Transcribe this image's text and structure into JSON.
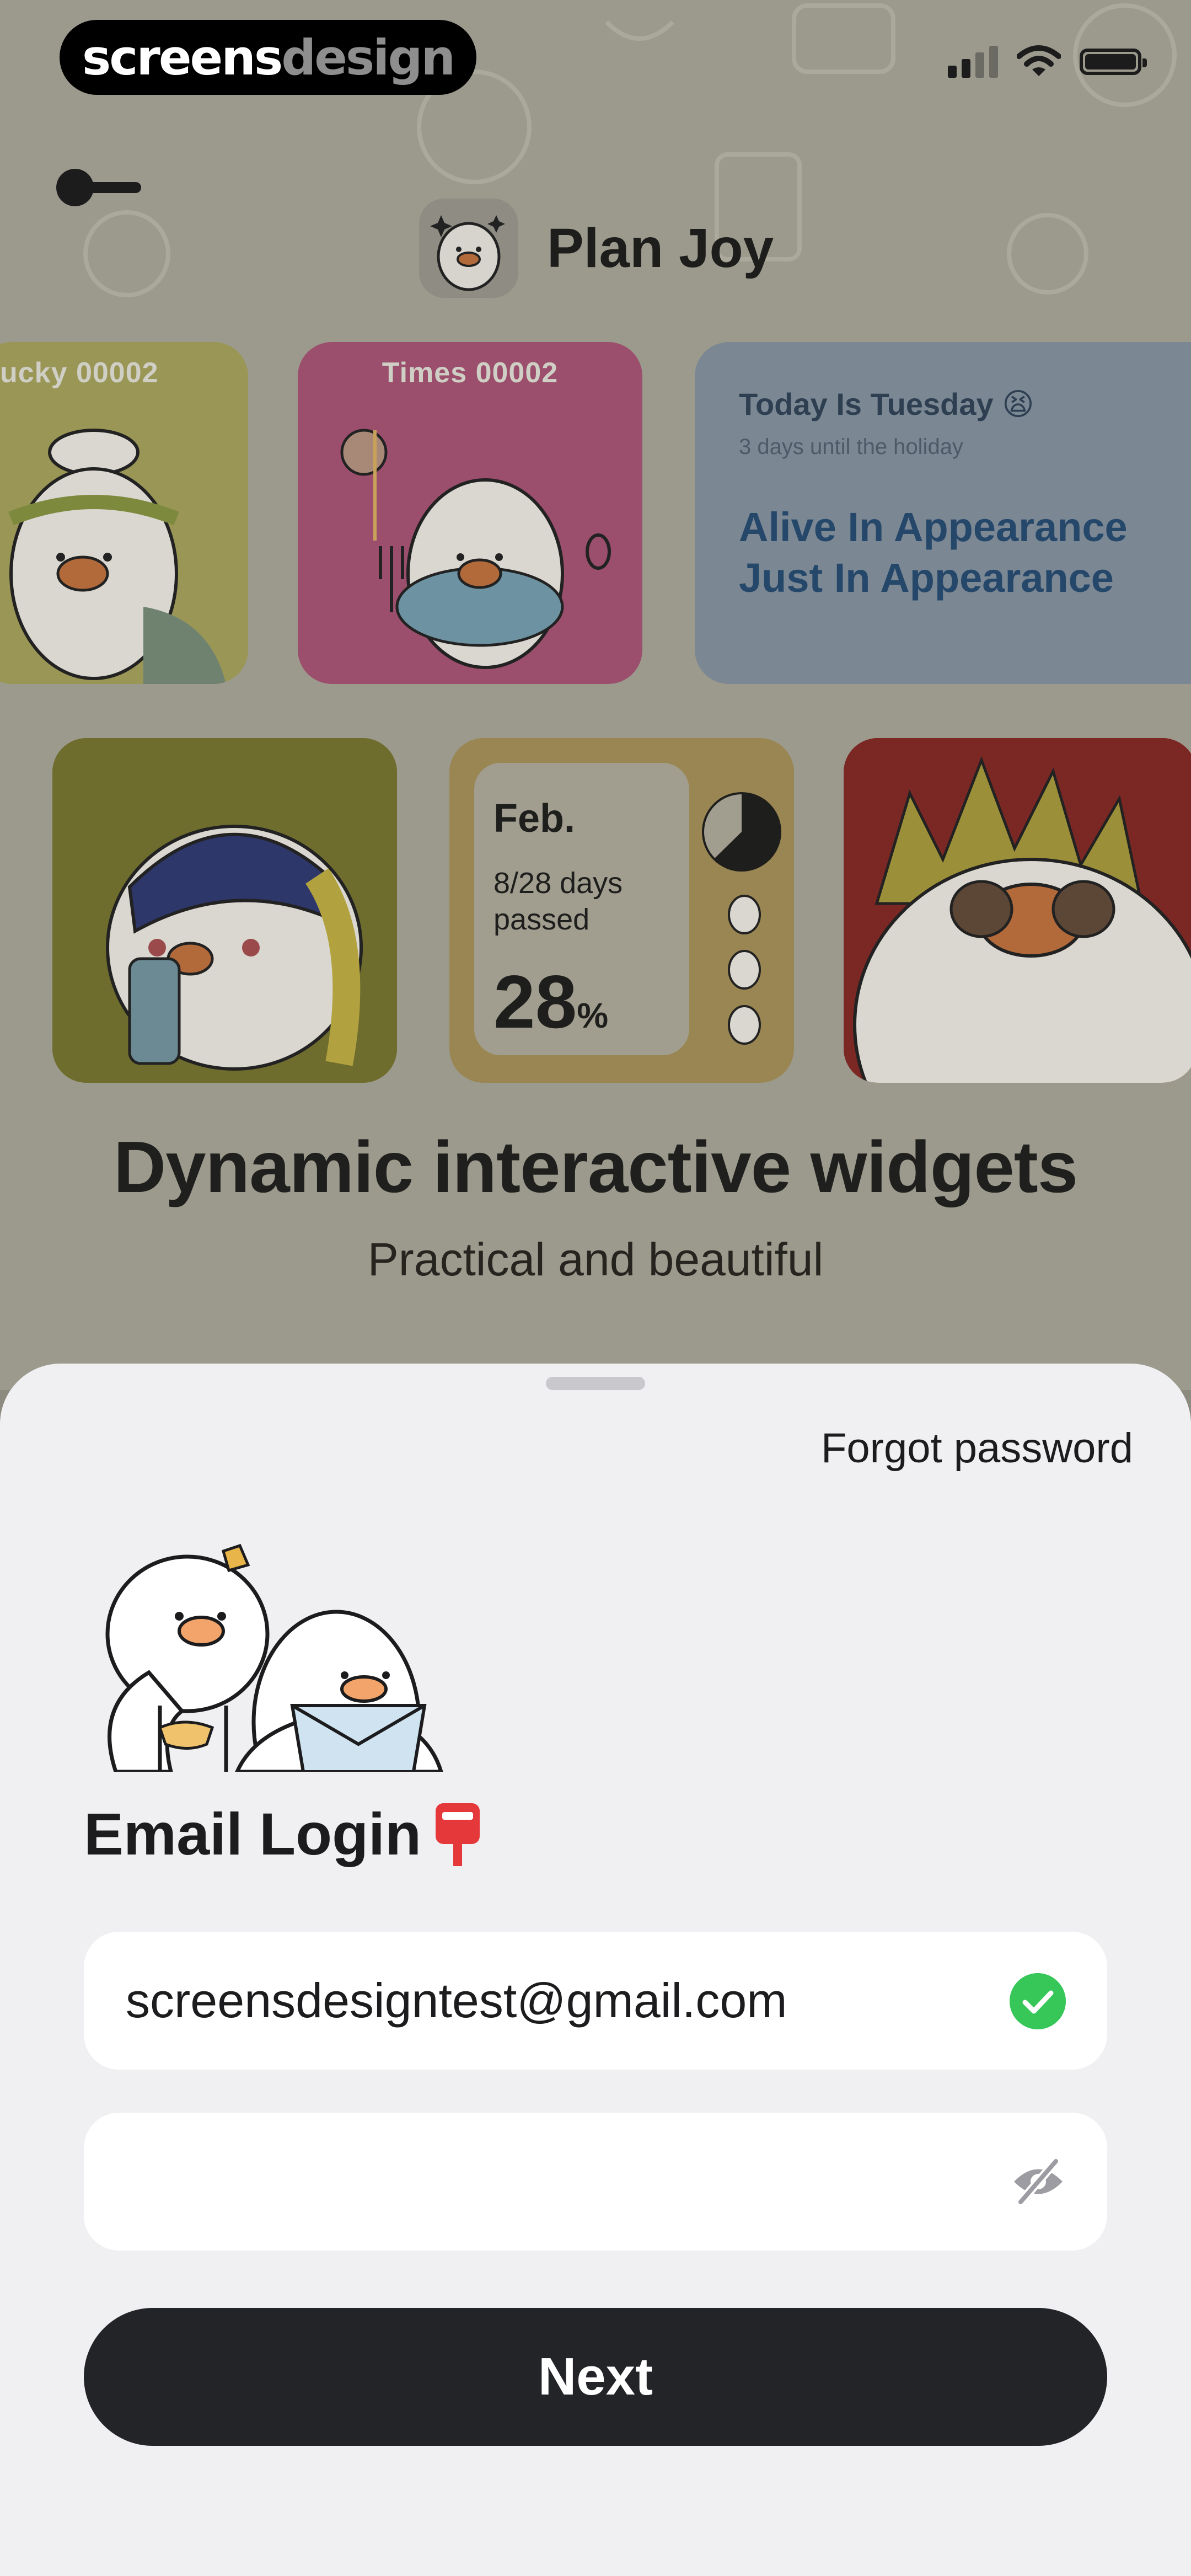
{
  "watermark": {
    "brand_strong": "screens",
    "brand_light": "design"
  },
  "status_bar": {
    "signal_icon": "signal-bars-icon",
    "wifi_icon": "wifi-icon",
    "battery_icon": "battery-icon"
  },
  "header": {
    "app_name": "Plan Joy",
    "back_icon": "arrow-left-icon"
  },
  "widgets": {
    "row1": [
      {
        "label": "ucky 00002"
      },
      {
        "label": "Times 00002"
      },
      {
        "title": "Today Is Tuesday",
        "emoji": "😫",
        "subtitle": "3 days until the holiday",
        "line1": "Alive In Appearance",
        "line2": "Just In Appearance"
      }
    ],
    "progress": {
      "month": "Feb.",
      "days_text": "8/28 days passed",
      "percent": "28",
      "percent_sign": "%"
    }
  },
  "promo": {
    "title": "Dynamic interactive widgets",
    "subtitle": "Practical and beautiful"
  },
  "login_sheet": {
    "forgot_password": "Forgot password",
    "title": "Email Login",
    "title_emoji": "📮",
    "email_value": "screensdesigntest@gmail.com",
    "email_valid_icon": "check-circle-icon",
    "password_placeholder": "",
    "password_toggle_icon": "eye-off-icon",
    "next_button": "Next"
  },
  "colors": {
    "accent_green": "#37c759",
    "button_dark": "#232428",
    "sheet_bg": "#f0f0f3"
  }
}
